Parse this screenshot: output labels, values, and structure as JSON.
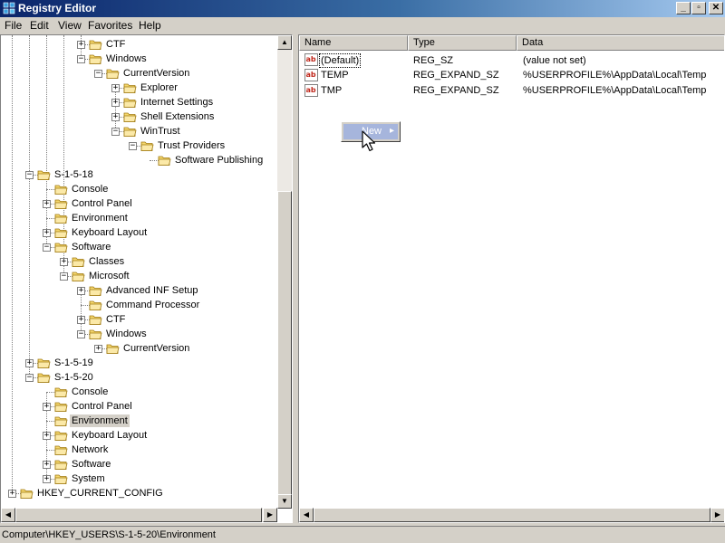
{
  "window": {
    "title": "Registry Editor",
    "minimize_glyph": "_",
    "maximize_glyph": "▫",
    "close_glyph": "✕"
  },
  "menu": [
    "File",
    "Edit",
    "View",
    "Favorites",
    "Help"
  ],
  "tree": [
    {
      "label": "CTF",
      "depth": 5,
      "expander": "plus"
    },
    {
      "label": "Windows",
      "depth": 5,
      "expander": "minus"
    },
    {
      "label": "CurrentVersion",
      "depth": 6,
      "expander": "minus"
    },
    {
      "label": "Explorer",
      "depth": 7,
      "expander": "plus"
    },
    {
      "label": "Internet Settings",
      "depth": 7,
      "expander": "plus"
    },
    {
      "label": "Shell Extensions",
      "depth": 7,
      "expander": "plus"
    },
    {
      "label": "WinTrust",
      "depth": 7,
      "expander": "minus"
    },
    {
      "label": "Trust Providers",
      "depth": 8,
      "expander": "minus"
    },
    {
      "label": "Software Publishing",
      "depth": 9,
      "expander": "none"
    },
    {
      "label": "S-1-5-18",
      "depth": 2,
      "expander": "minus"
    },
    {
      "label": "Console",
      "depth": 3,
      "expander": "none"
    },
    {
      "label": "Control Panel",
      "depth": 3,
      "expander": "plus"
    },
    {
      "label": "Environment",
      "depth": 3,
      "expander": "none"
    },
    {
      "label": "Keyboard Layout",
      "depth": 3,
      "expander": "plus"
    },
    {
      "label": "Software",
      "depth": 3,
      "expander": "minus"
    },
    {
      "label": "Classes",
      "depth": 4,
      "expander": "plus"
    },
    {
      "label": "Microsoft",
      "depth": 4,
      "expander": "minus"
    },
    {
      "label": "Advanced INF Setup",
      "depth": 5,
      "expander": "plus"
    },
    {
      "label": "Command Processor",
      "depth": 5,
      "expander": "none"
    },
    {
      "label": "CTF",
      "depth": 5,
      "expander": "plus"
    },
    {
      "label": "Windows",
      "depth": 5,
      "expander": "minus"
    },
    {
      "label": "CurrentVersion",
      "depth": 6,
      "expander": "plus"
    },
    {
      "label": "S-1-5-19",
      "depth": 2,
      "expander": "plus"
    },
    {
      "label": "S-1-5-20",
      "depth": 2,
      "expander": "minus"
    },
    {
      "label": "Console",
      "depth": 3,
      "expander": "none"
    },
    {
      "label": "Control Panel",
      "depth": 3,
      "expander": "plus"
    },
    {
      "label": "Environment",
      "depth": 3,
      "expander": "none",
      "selected": true
    },
    {
      "label": "Keyboard Layout",
      "depth": 3,
      "expander": "plus"
    },
    {
      "label": "Network",
      "depth": 3,
      "expander": "none"
    },
    {
      "label": "Software",
      "depth": 3,
      "expander": "plus"
    },
    {
      "label": "System",
      "depth": 3,
      "expander": "plus"
    },
    {
      "label": "HKEY_CURRENT_CONFIG",
      "depth": 1,
      "expander": "plus"
    }
  ],
  "columns": {
    "name": "Name",
    "type": "Type",
    "data": "Data"
  },
  "values": [
    {
      "name": "(Default)",
      "type": "REG_SZ",
      "data": "(value not set)",
      "focused": true
    },
    {
      "name": "TEMP",
      "type": "REG_EXPAND_SZ",
      "data": "%USERPROFILE%\\AppData\\Local\\Temp"
    },
    {
      "name": "TMP",
      "type": "REG_EXPAND_SZ",
      "data": "%USERPROFILE%\\AppData\\Local\\Temp"
    }
  ],
  "value_icon_text": "ab",
  "context_menu": {
    "item": "New",
    "arrow": "▸"
  },
  "status": "Computer\\HKEY_USERS\\S-1-5-20\\Environment",
  "scroll_glyphs": {
    "up": "▲",
    "down": "▼",
    "left": "◀",
    "right": "▶"
  },
  "colors": {
    "title_start": "#0a246a",
    "title_end": "#a6caf0",
    "selection": "#d4d0c8",
    "folder": "#f5d76e"
  }
}
